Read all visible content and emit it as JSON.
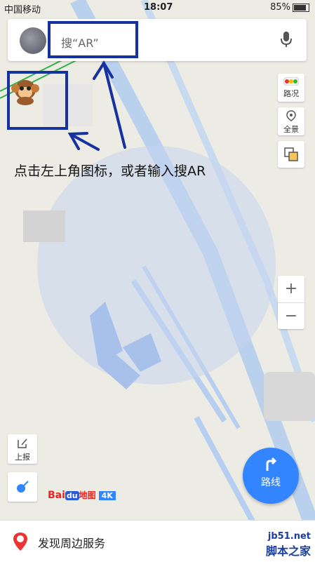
{
  "status": {
    "carrier": "中国移动",
    "time": "18:07",
    "battery": "85%"
  },
  "search": {
    "text": "搜“AR”"
  },
  "annotation": {
    "hint": "点击左上角图标，或者输入搜AR"
  },
  "side": {
    "traffic": "路况",
    "panorama": "全景"
  },
  "zoom": {
    "in": "+",
    "out": "−"
  },
  "report": {
    "label": "上报"
  },
  "route": {
    "label": "路线"
  },
  "logo": {
    "bai": "Bai",
    "du": "du",
    "map": "地图",
    "k4": "4K"
  },
  "bottom": {
    "label": "发现周边服务"
  },
  "watermark": {
    "site": "jb51.net",
    "name": "脚本之家"
  },
  "colors": {
    "route_blue": "#3385ff",
    "annotation_blue": "#1631a0",
    "map_bg": "#ecebe4"
  }
}
